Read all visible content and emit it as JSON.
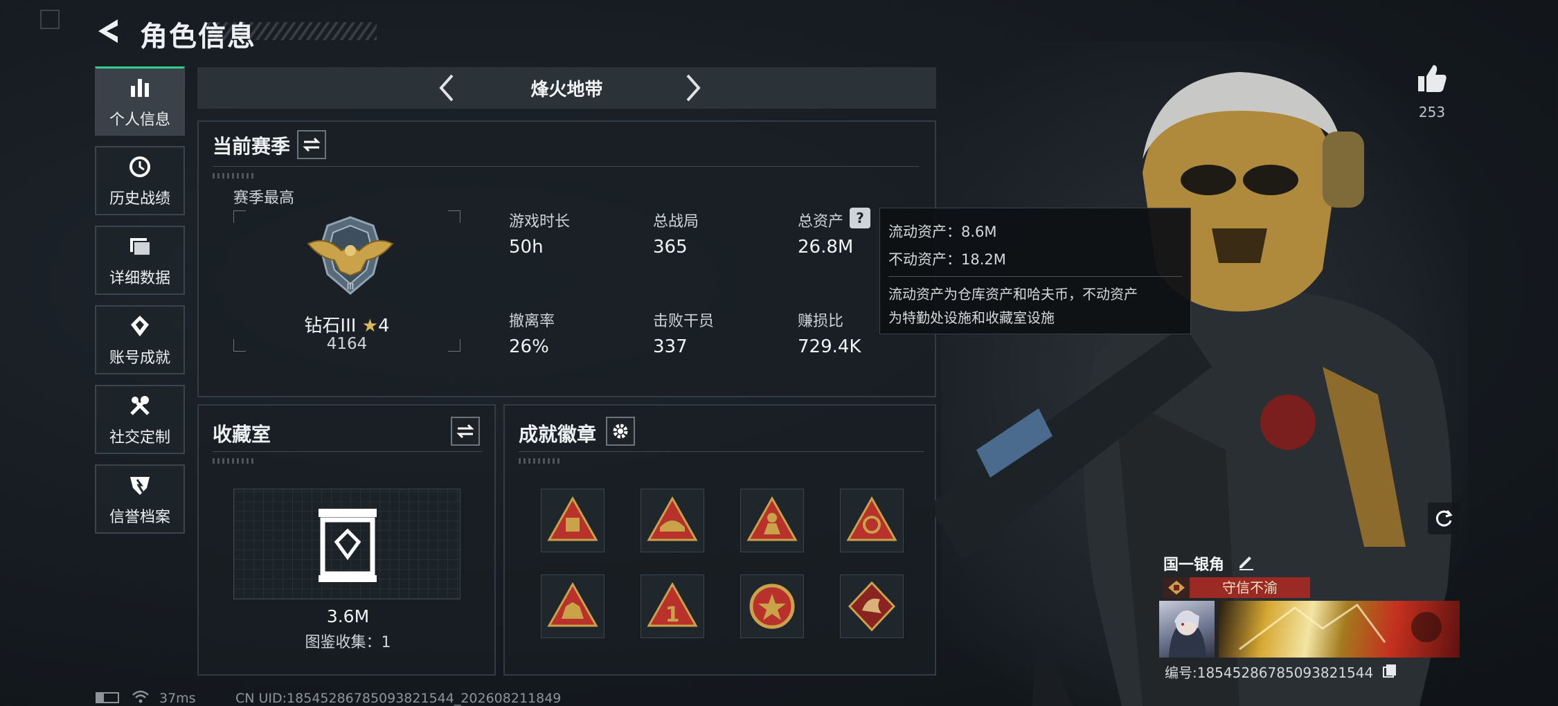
{
  "header": {
    "title": "角色信息"
  },
  "nav": {
    "items": [
      {
        "label": "个人信息",
        "icon": "bar-chart-icon",
        "active": true
      },
      {
        "label": "历史战绩",
        "icon": "history-icon"
      },
      {
        "label": "详细数据",
        "icon": "folder-icon"
      },
      {
        "label": "账号成就",
        "icon": "achievement-icon"
      },
      {
        "label": "社交定制",
        "icon": "tools-icon"
      },
      {
        "label": "信誉档案",
        "icon": "shield-icon"
      }
    ]
  },
  "mode": {
    "label": "烽火地带"
  },
  "season": {
    "title": "当前赛季",
    "best_label": "赛季最高",
    "rank_name": "钻石III",
    "rank_stars": "4",
    "rank_points": "4164",
    "stats": [
      {
        "label": "游戏时长",
        "value": "50h"
      },
      {
        "label": "总战局",
        "value": "365"
      },
      {
        "label": "总资产",
        "value": "26.8M"
      },
      {
        "label": "撤离率",
        "value": "26%"
      },
      {
        "label": "击败干员",
        "value": "337"
      },
      {
        "label": "赚损比",
        "value": "729.4K"
      }
    ]
  },
  "tooltip": {
    "liquid": "流动资产：8.6M",
    "fixed": "不动资产：18.2M",
    "desc1": "流动资产为仓库资产和哈夫币，不动资产",
    "desc2": "为特勤处设施和收藏室设施"
  },
  "collection": {
    "title": "收藏室",
    "value": "3.6M",
    "catalog": "图鉴收集：1"
  },
  "badges": {
    "title": "成就徽章",
    "items": [
      "badge-supply-icon",
      "badge-tank-icon",
      "badge-soldier-icon",
      "badge-emblem-icon",
      "badge-beast-icon",
      "badge-number-one-icon",
      "badge-star-medal-icon",
      "badge-dragon-icon"
    ]
  },
  "likes": {
    "count": "253"
  },
  "player": {
    "name": "国一银角",
    "title_badge": "守信不渝",
    "id_label": "编号:18545286785093821544"
  },
  "status": {
    "ping": "37ms",
    "uid": "CN UID:18545286785093821544_202608211849"
  },
  "colors": {
    "accent": "#33d08a",
    "panel_border": "#333c44",
    "title_red": "#b8322b",
    "gold": "#c9a24a"
  }
}
